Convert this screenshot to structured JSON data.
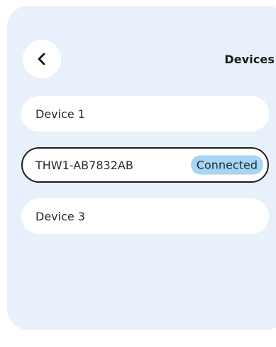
{
  "header": {
    "back_icon": "chevron-left-icon",
    "title": "Devices"
  },
  "devices": [
    {
      "name": "Device 1",
      "selected": false,
      "status": ""
    },
    {
      "name": "THW1-AB7832AB",
      "selected": true,
      "status": "Connected"
    },
    {
      "name": "Device 3",
      "selected": false,
      "status": ""
    }
  ],
  "colors": {
    "panel_background": "#e8f1fb",
    "row_background": "#ffffff",
    "selected_border": "#1e1e1e",
    "connected_badge": "#a7d5f2"
  }
}
